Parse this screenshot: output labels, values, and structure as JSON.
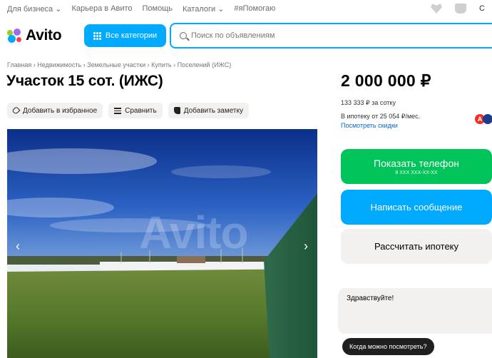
{
  "topbar": {
    "links": [
      "Для бизнеса ⌄",
      "Карьера в Авито",
      "Помощь",
      "Каталоги ⌄",
      "#яПомогаю"
    ],
    "right_letter": "С"
  },
  "header": {
    "logo": "Avito",
    "categories_button": "Все категории",
    "search_placeholder": "Поиск по объявлениям"
  },
  "breadcrumbs": "Главная › Недвижимость › Земельные участки › Купить › Поселений (ИЖС)",
  "listing": {
    "title": "Участок 15 сот. (ИЖС)",
    "actions": {
      "favorite": "Добавить в избранное",
      "compare": "Сравнить",
      "note": "Добавить заметку"
    },
    "photo_watermark": "Avito"
  },
  "pricing": {
    "price": "2 000 000 ₽",
    "per_unit": "133 333 ₽ за сотку",
    "mortgage": "В ипотеку от 25 054 ₽/мес.",
    "discounts_link": "Посмотреть скидки",
    "bank_badge": "А"
  },
  "contact": {
    "show_phone": "Показать телефон",
    "phone_masked": "8 XXX XXX-XX-XX",
    "write_message": "Написать сообщение",
    "calc_mortgage": "Рассчитать ипотеку"
  },
  "chat": {
    "draft": "Здравствуйте!",
    "quick_reply": "Когда можно посмотреть?"
  }
}
